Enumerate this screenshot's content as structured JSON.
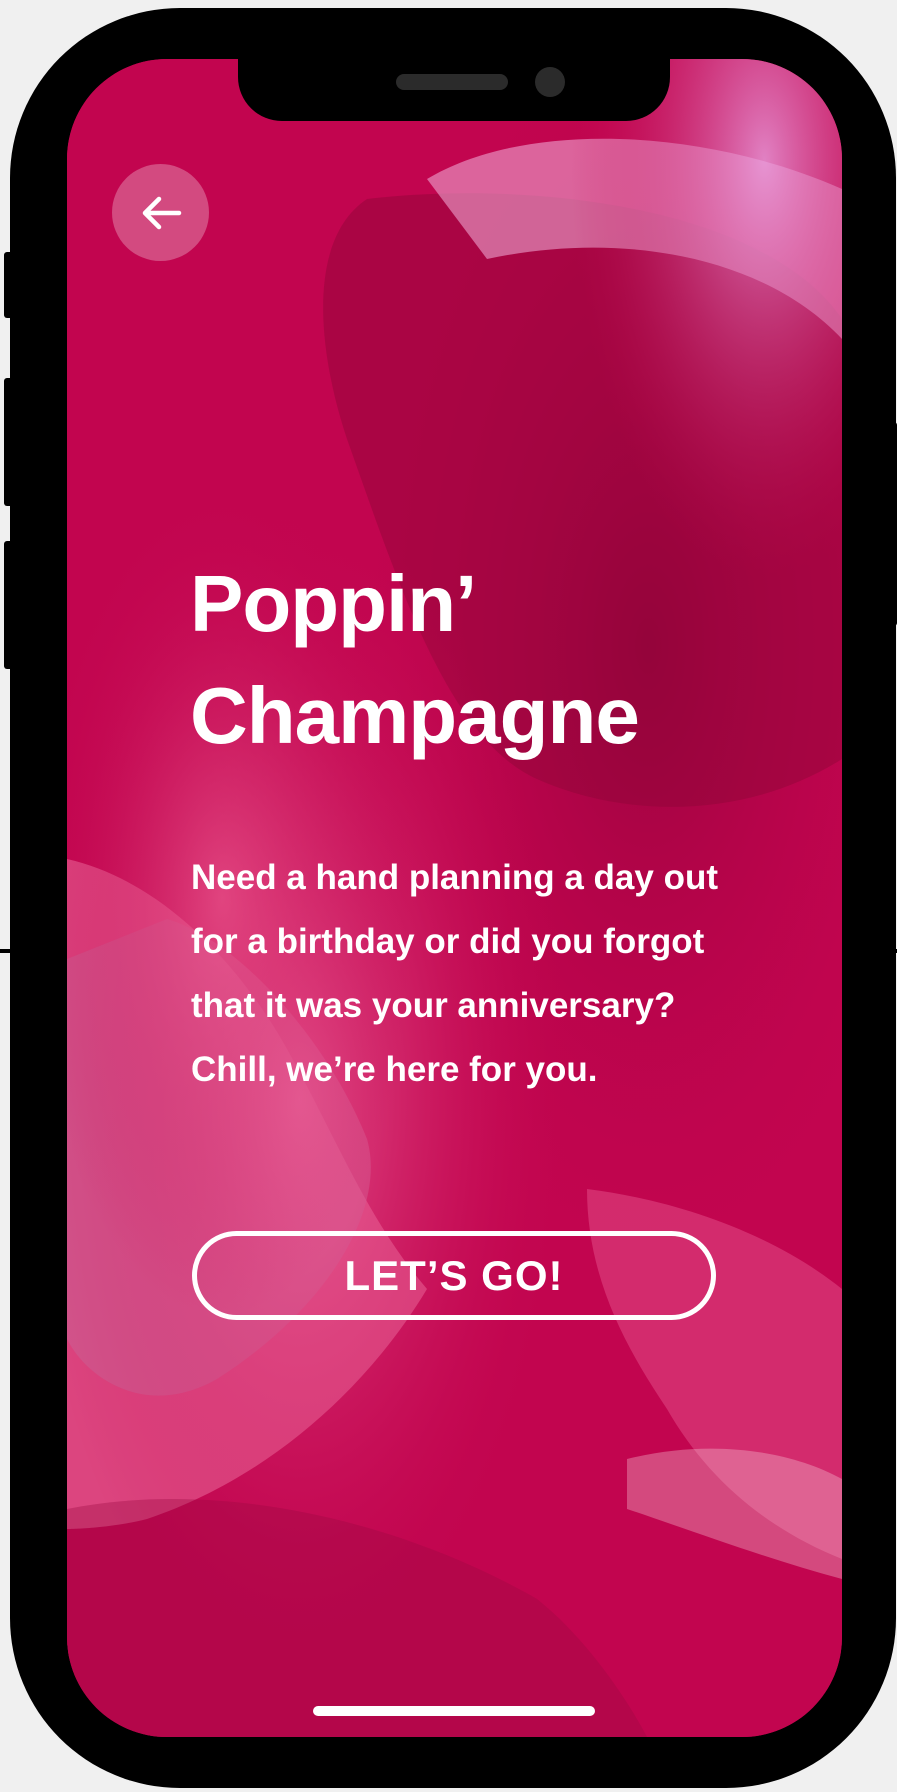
{
  "screen": {
    "title_lines": [
      "Poppin’",
      "Champagne"
    ],
    "body_lines": [
      "Need a hand planning a day out",
      "for a birthday or did you forgot",
      "that it was your anniversary?",
      "Chill, we’re here for you."
    ],
    "cta_label": "LET’S GO!",
    "back_icon": "arrow-left-icon",
    "overlay_color": "#c2054f",
    "accent_color": "#ffffff"
  }
}
